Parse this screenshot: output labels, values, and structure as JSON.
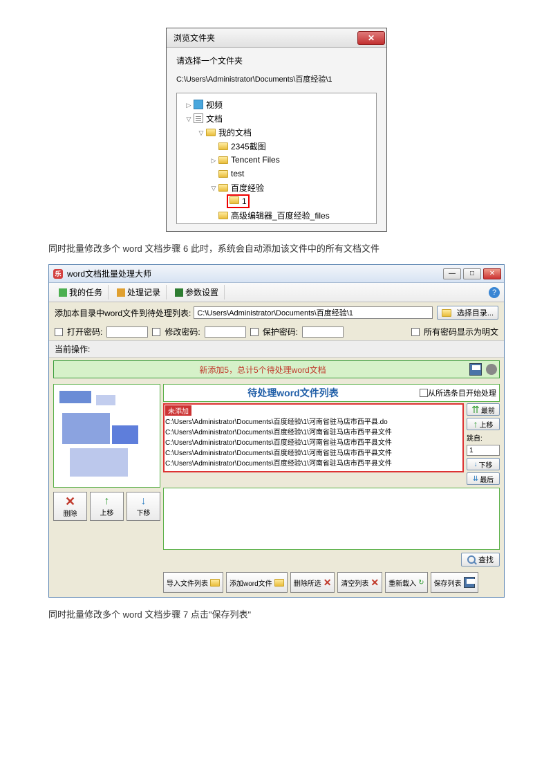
{
  "dialog1": {
    "title": "浏览文件夹",
    "instruction": "请选择一个文件夹",
    "path": "C:\\Users\\Administrator\\Documents\\百度经验\\1",
    "tree": {
      "video": "视频",
      "docs": "文档",
      "mydocs": "我的文档",
      "screenshots": "2345截图",
      "tencent": "Tencent Files",
      "test": "test",
      "baidu": "百度经验",
      "one": "1",
      "editor": "高级编辑器_百度经验_files"
    }
  },
  "caption6": "同时批量修改多个 word 文档步骤 6 此时，系统会自动添加该文件中的所有文档文件",
  "caption7": "同时批量修改多个 word 文档步骤 7 点击\"保存列表\"",
  "app": {
    "title": "word文档批量处理大师",
    "tabs": {
      "tasks": "我的任务",
      "records": "处理记录",
      "params": "参数设置"
    },
    "addline": {
      "label": "添加本目录中word文件到待处理列表:",
      "path": "C:\\Users\\Administrator\\Documents\\百度经验\\1",
      "browse": "选择目录..."
    },
    "pw": {
      "open": "打开密码:",
      "modify": "修改密码:",
      "protect": "保护密码:",
      "showplain": "所有密码显示为明文"
    },
    "cur_op_label": "当前操作:",
    "status_msg": "新添加5，总计5个待处理word文档",
    "list_title": "待处理word文件列表",
    "start_from_sel": "从所选条目开始处理",
    "files_tab": "未添加",
    "files": [
      "C:\\Users\\Administrator\\Documents\\百度经验\\1\\河南省驻马店市西平县.do",
      "C:\\Users\\Administrator\\Documents\\百度经验\\1\\河南省驻马店市西平县文件",
      "C:\\Users\\Administrator\\Documents\\百度经验\\1\\河南省驻马店市西平县文件",
      "C:\\Users\\Administrator\\Documents\\百度经验\\1\\河南省驻马店市西平县文件",
      "C:\\Users\\Administrator\\Documents\\百度经验\\1\\河南省驻马店市西平县文件"
    ],
    "side": {
      "top": "最前",
      "up": "上移",
      "num_label": "跳自:",
      "num": "1",
      "down": "下移",
      "bottom": "最后"
    },
    "left_btns": {
      "remove": "删除",
      "up": "上移",
      "down": "下移"
    },
    "find": "查找",
    "bottom": {
      "import": "导入文件列表",
      "addword": "添加word文件",
      "delsel": "删除所选",
      "clear": "清空列表",
      "reload": "重新载入",
      "save": "保存列表"
    }
  }
}
